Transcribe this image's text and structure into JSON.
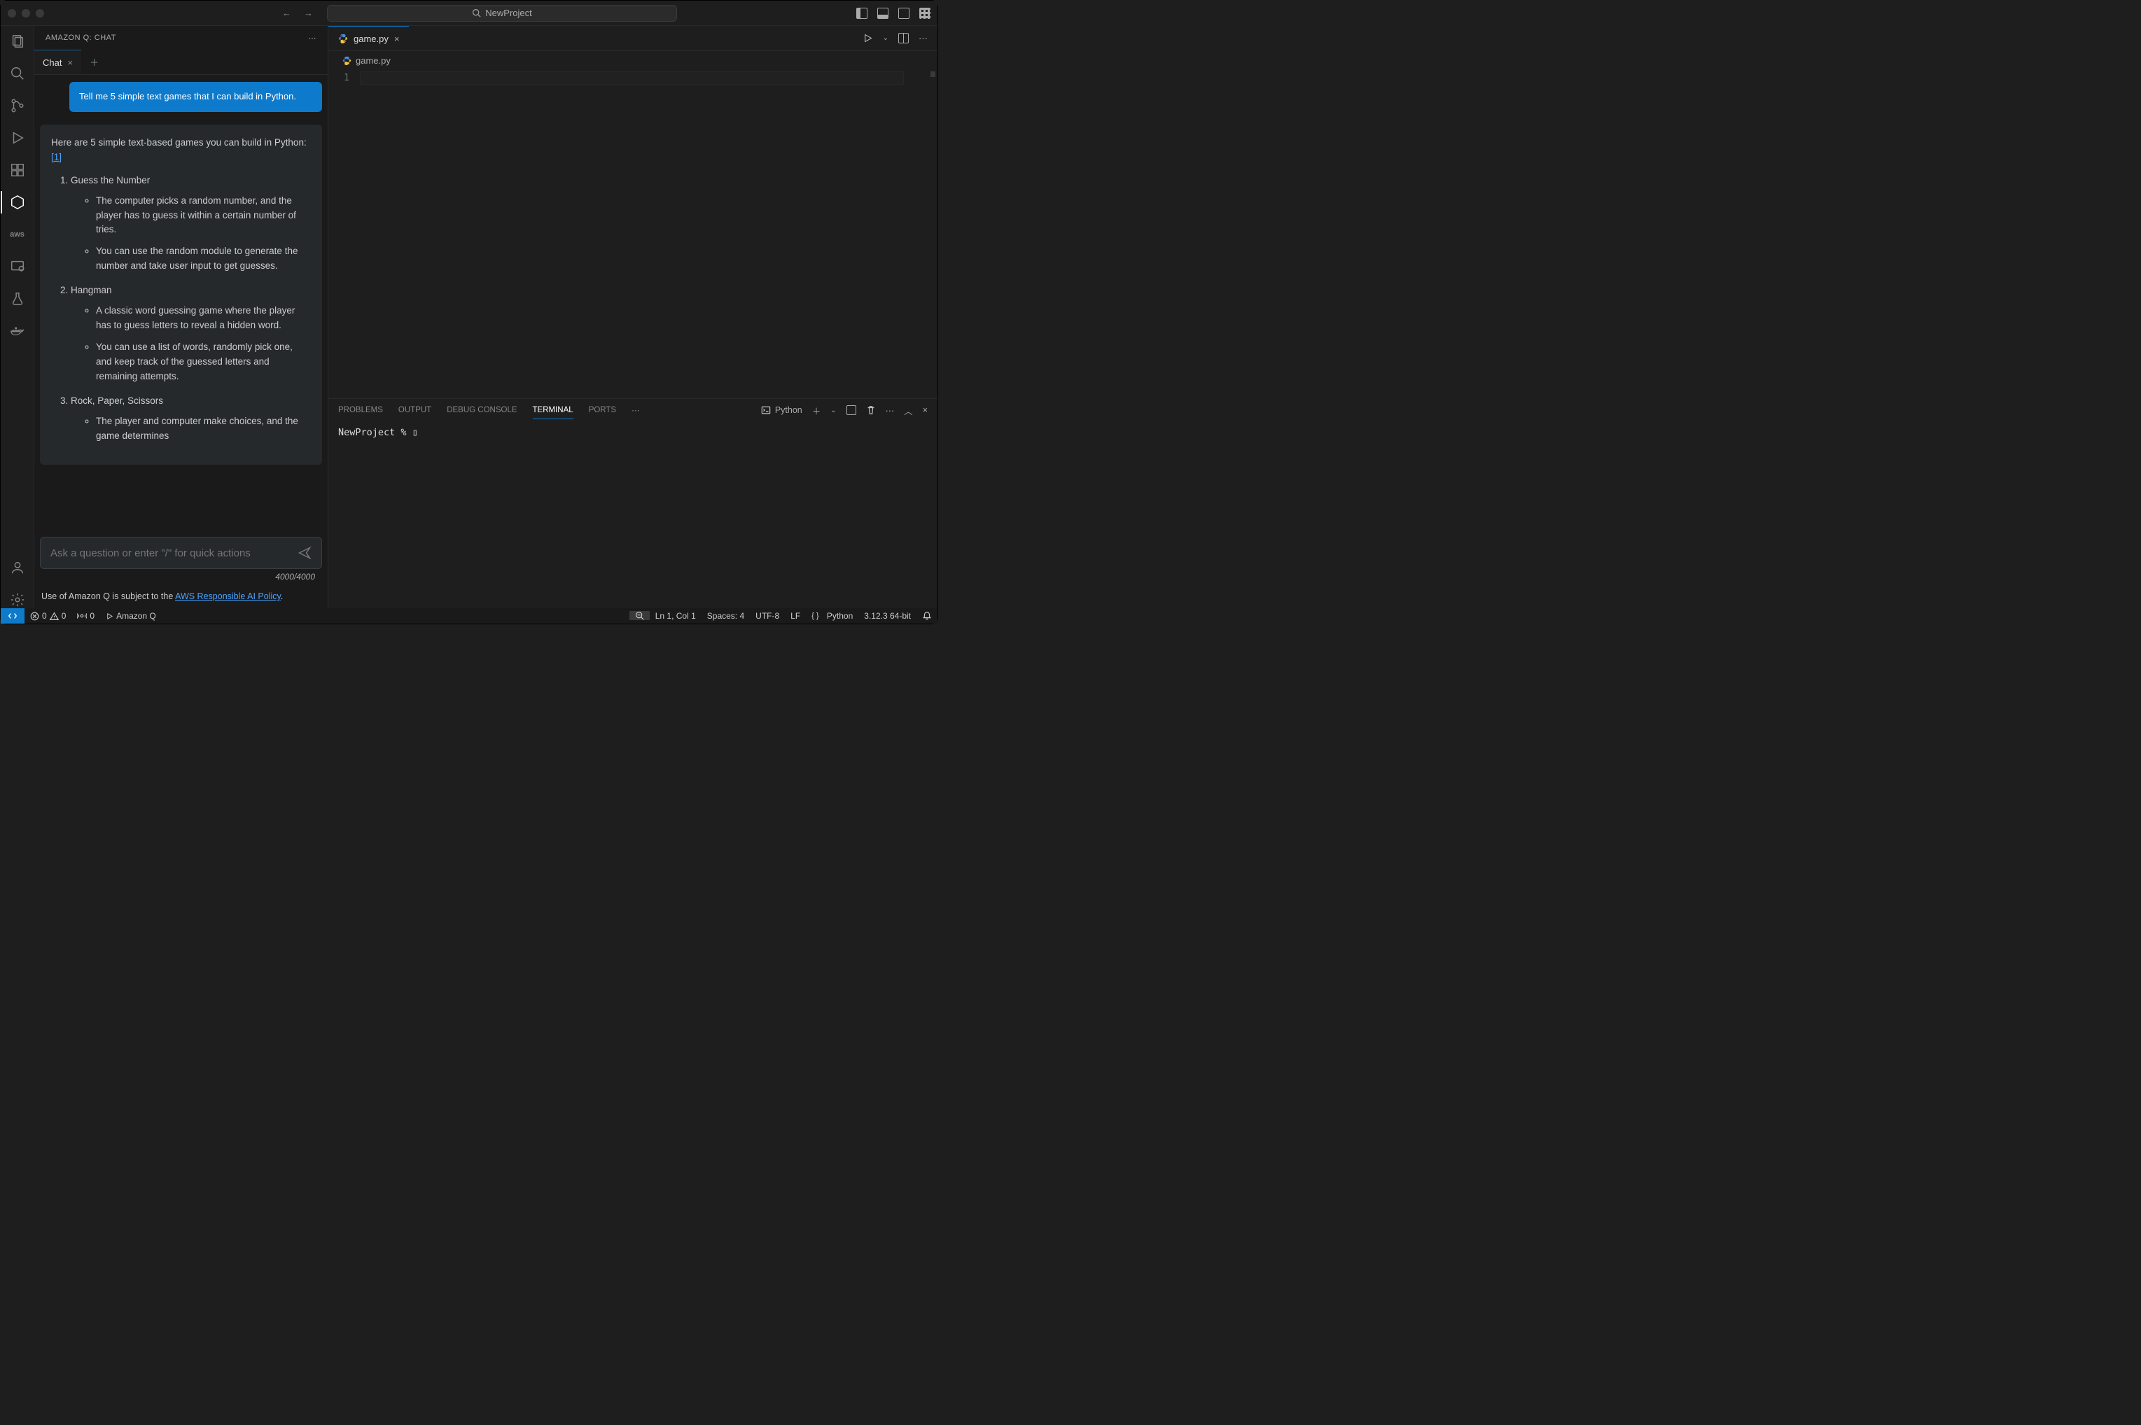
{
  "titlebar": {
    "project": "NewProject"
  },
  "sidebar": {
    "title": "AMAZON Q: CHAT",
    "tab": "Chat",
    "user_msg": "Tell me 5 simple text games that I can build in Python.",
    "assistant": {
      "intro_a": "Here are 5 simple text-based games you can build in Python: ",
      "cite": "[1]",
      "g1_title": "Guess the Number",
      "g1_b1": "The computer picks a random number, and the player has to guess it within a certain number of tries.",
      "g1_b2": "You can use the random module to generate the number and take user input to get guesses.",
      "g2_title": "Hangman",
      "g2_b1": "A classic word guessing game where the player has to guess letters to reveal a hidden word.",
      "g2_b2": "You can use a list of words, randomly pick one, and keep track of the guessed letters and remaining attempts.",
      "g3_title": "Rock, Paper, Scissors",
      "g3_b1": "The player and computer make choices, and the game determines"
    },
    "input_placeholder": "Ask a question or enter \"/\" for quick actions",
    "char_count": "4000/4000",
    "policy_prefix": "Use of Amazon Q is subject to the ",
    "policy_link": "AWS Responsible AI Policy",
    "policy_suffix": "."
  },
  "editor": {
    "tab": "game.py",
    "breadcrumb": "game.py",
    "line1": "1"
  },
  "panel": {
    "tabs": {
      "problems": "PROBLEMS",
      "output": "OUTPUT",
      "debug": "DEBUG CONSOLE",
      "terminal": "TERMINAL",
      "ports": "PORTS"
    },
    "shell": "Python",
    "prompt": "NewProject % ▯"
  },
  "status": {
    "errors": "0",
    "warnings": "0",
    "ports": "0",
    "amazonq": "Amazon Q",
    "ln": "Ln 1, Col 1",
    "spaces": "Spaces: 4",
    "encoding": "UTF-8",
    "eol": "LF",
    "lang": "Python",
    "interp": "3.12.3 64-bit"
  }
}
